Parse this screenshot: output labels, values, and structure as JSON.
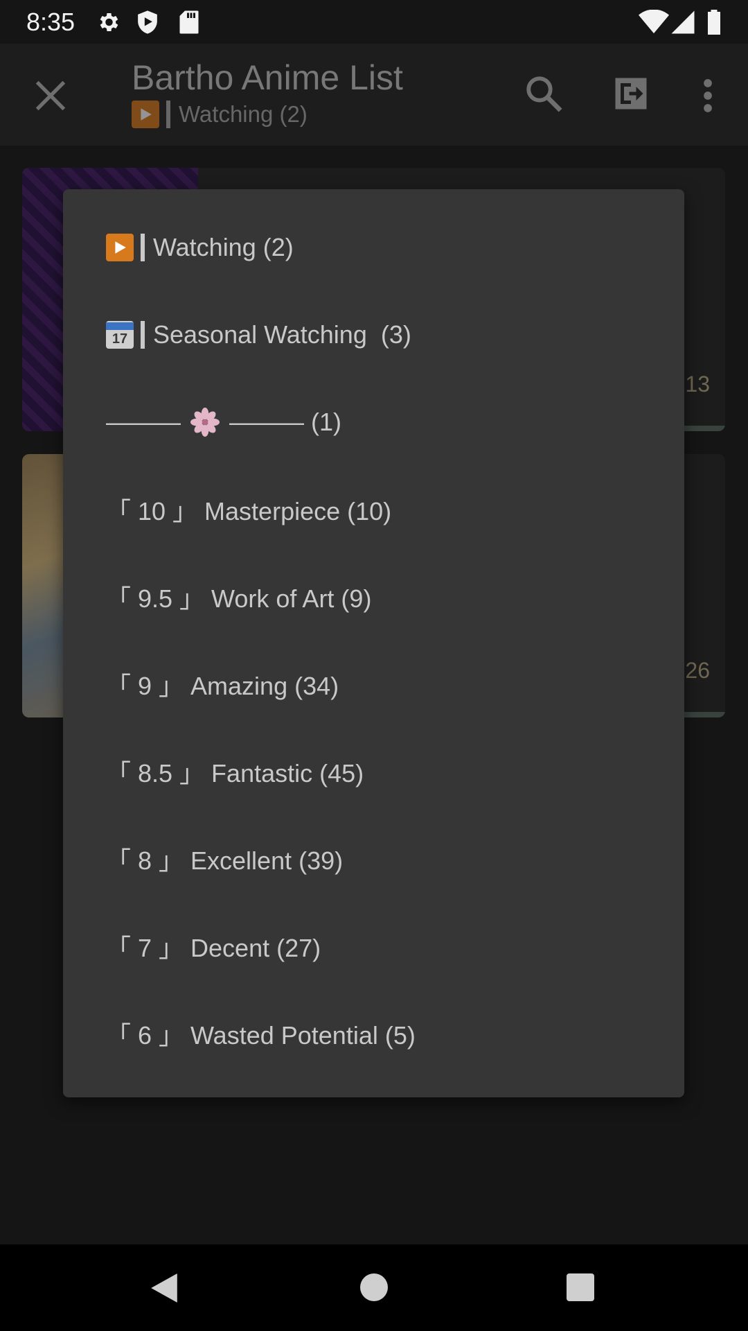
{
  "status_bar": {
    "time": "8:35",
    "icons": [
      "gear-icon",
      "shield-icon",
      "sd-card-icon",
      "wifi-icon",
      "cell-signal-icon",
      "battery-icon"
    ]
  },
  "app_bar": {
    "title": "Bartho Anime List",
    "subtitle": "Watching (2)",
    "icons": [
      "close-icon",
      "search-icon",
      "switch-icon",
      "overflow-menu-icon"
    ]
  },
  "cards": [
    {
      "count": "13"
    },
    {
      "count": "26"
    }
  ],
  "menu": {
    "items": [
      {
        "prefix_icon": "play-button-icon",
        "label": "Watching (2)"
      },
      {
        "prefix_icon": "calendar-icon",
        "calendar_month": "July",
        "calendar_day": "17",
        "label": "Seasonal Watching  (3)"
      },
      {
        "prefix_icon": "flower-icon",
        "label_left": "———",
        "label_right": "——— (1)"
      },
      {
        "label": "「 10 」 Masterpiece (10)"
      },
      {
        "label": "「 9.5 」 Work of Art (9)"
      },
      {
        "label": "「 9 」 Amazing (34)"
      },
      {
        "label": "「 8.5 」 Fantastic (45)"
      },
      {
        "label": "「 8 」 Excellent (39)"
      },
      {
        "label": "「 7 」 Decent (27)"
      },
      {
        "label": "「 6 」 Wasted Potential (5)"
      }
    ]
  },
  "nav_bar": {
    "icons": [
      "back-icon",
      "home-icon",
      "recents-icon"
    ]
  },
  "colors": {
    "menu_background": "#363636",
    "app_bar_background": "#262626",
    "text": "#c9c9c9",
    "accent_play": "#d77a1e"
  }
}
